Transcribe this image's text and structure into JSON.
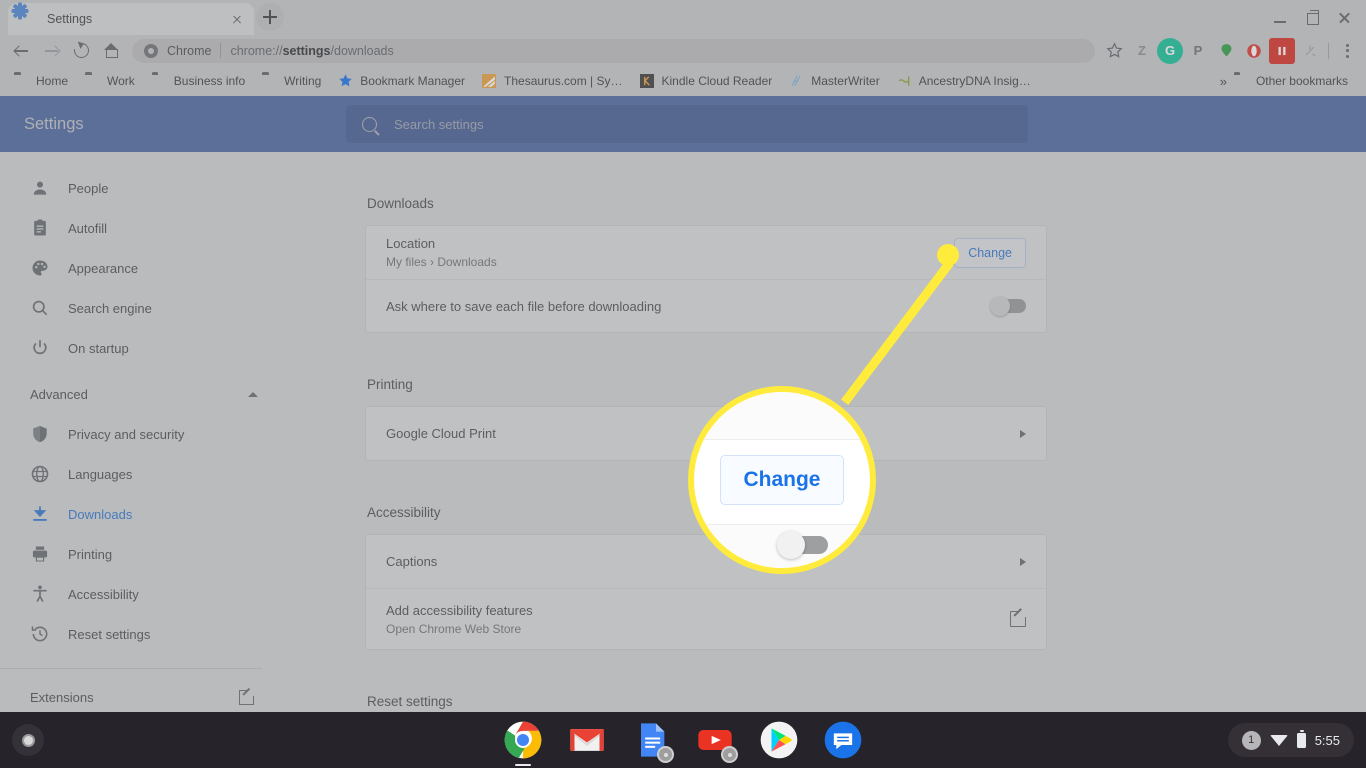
{
  "browser": {
    "tab": {
      "title": "Settings",
      "favicon": "gear-icon",
      "close": "close-icon"
    },
    "new_tab_label": "+",
    "window_controls": {
      "minimize": "minimize-icon",
      "maximize": "maximize-icon",
      "close": "close-icon"
    },
    "toolbar": {
      "back": "back-arrow-icon",
      "forward": "forward-arrow-icon",
      "reload": "reload-icon",
      "home": "home-icon",
      "omnibox": {
        "brand": "Chrome",
        "url_prefix": "chrome://",
        "url_bold": "settings",
        "url_suffix": "/downloads",
        "full_url": "chrome://settings/downloads"
      },
      "bookmark_star": "star-icon",
      "extensions": [
        {
          "name": "zotero-extension",
          "glyph": "Z",
          "color": "#8d8f92",
          "bg": "transparent"
        },
        {
          "name": "grammarly-extension",
          "glyph": "G",
          "color": "#ffffff",
          "bg": "#15c39a"
        },
        {
          "name": "pinterest-extension",
          "glyph": "P",
          "color": "#6e7174",
          "bg": "transparent"
        },
        {
          "name": "evernote-extension",
          "glyph": "●",
          "color": "#2f9e44",
          "bg": "transparent"
        },
        {
          "name": "opera-extension",
          "glyph": "O",
          "color": "#e0342e",
          "bg": "transparent"
        },
        {
          "name": "honey-extension",
          "glyph": "▮▮",
          "color": "#ffffff",
          "bg": "#d93025"
        },
        {
          "name": "unknown-extension",
          "glyph": "❇",
          "color": "#a0a2a5",
          "bg": "transparent"
        }
      ],
      "menu": "three-dot-menu-icon"
    },
    "bookmarks": [
      {
        "label": "Home",
        "icon": "folder-icon"
      },
      {
        "label": "Work",
        "icon": "folder-icon"
      },
      {
        "label": "Business info",
        "icon": "folder-icon"
      },
      {
        "label": "Writing",
        "icon": "folder-icon"
      },
      {
        "label": "Bookmark Manager",
        "icon": "star-icon"
      },
      {
        "label": "Thesaurus.com | Sy…",
        "icon": "thesaurus-icon"
      },
      {
        "label": "Kindle Cloud Reader",
        "icon": "kindle-icon"
      },
      {
        "label": "MasterWriter",
        "icon": "masterwriter-icon"
      },
      {
        "label": "AncestryDNA Insig…",
        "icon": "ancestry-icon"
      }
    ],
    "bookmarks_overflow": "»",
    "other_bookmarks": {
      "label": "Other bookmarks",
      "icon": "folder-icon"
    }
  },
  "settings": {
    "title": "Settings",
    "search": {
      "placeholder": "Search settings",
      "icon": "search-icon",
      "value": ""
    },
    "sidebar": {
      "items": [
        {
          "label": "People",
          "icon": "person-icon",
          "active": false
        },
        {
          "label": "Autofill",
          "icon": "clipboard-icon",
          "active": false
        },
        {
          "label": "Appearance",
          "icon": "palette-icon",
          "active": false
        },
        {
          "label": "Search engine",
          "icon": "search-icon",
          "active": false
        },
        {
          "label": "On startup",
          "icon": "power-icon",
          "active": false
        }
      ],
      "advanced": {
        "label": "Advanced",
        "icon": "chevron-up-icon",
        "expanded": true
      },
      "advanced_items": [
        {
          "label": "Privacy and security",
          "icon": "shield-icon",
          "active": false
        },
        {
          "label": "Languages",
          "icon": "globe-icon",
          "active": false
        },
        {
          "label": "Downloads",
          "icon": "download-icon",
          "active": true
        },
        {
          "label": "Printing",
          "icon": "printer-icon",
          "active": false
        },
        {
          "label": "Accessibility",
          "icon": "accessibility-icon",
          "active": false
        },
        {
          "label": "Reset settings",
          "icon": "history-icon",
          "active": false
        }
      ],
      "extensions": {
        "label": "Extensions",
        "icon": "external-link-icon"
      }
    },
    "sections": [
      {
        "title": "Downloads",
        "rows": [
          {
            "label": "Location",
            "sub": "My files › Downloads",
            "control": "button",
            "button_label": "Change"
          },
          {
            "label": "Ask where to save each file before downloading",
            "sub": "",
            "control": "toggle",
            "toggle_on": false
          }
        ]
      },
      {
        "title": "Printing",
        "rows": [
          {
            "label": "Google Cloud Print",
            "sub": "",
            "control": "chevron"
          }
        ]
      },
      {
        "title": "Accessibility",
        "rows": [
          {
            "label": "Captions",
            "sub": "",
            "control": "chevron"
          },
          {
            "label": "Add accessibility features",
            "sub": "Open Chrome Web Store",
            "control": "external"
          }
        ]
      },
      {
        "title": "Reset settings",
        "rows": []
      }
    ]
  },
  "callout": {
    "magnified_button_label": "Change",
    "highlight_color": "#ffeb3b",
    "accent_color": "#1a73e8"
  },
  "shelf": {
    "launcher": "launcher-icon",
    "apps": [
      {
        "name": "chrome-app",
        "active": true
      },
      {
        "name": "gmail-app",
        "active": false
      },
      {
        "name": "google-docs-app",
        "active": false
      },
      {
        "name": "youtube-app",
        "active": false
      },
      {
        "name": "play-store-app",
        "active": false
      },
      {
        "name": "messages-app",
        "active": false
      }
    ],
    "status": {
      "notification_count": "1",
      "wifi": "wifi-icon",
      "battery": "battery-icon",
      "time": "5:55"
    }
  }
}
